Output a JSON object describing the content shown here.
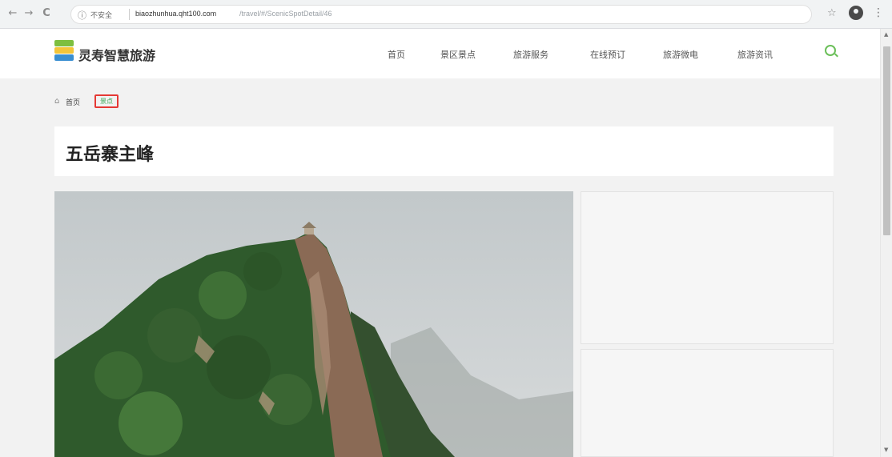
{
  "browser": {
    "back": "←",
    "forward": "→",
    "reload": "C",
    "info_icon": "ⓘ",
    "insecure": "不安全",
    "host": "biaozhunhua.qht100.com",
    "path": "/travel/#/ScenicSpotDetail/46",
    "star": "☆",
    "more": "⋮"
  },
  "header": {
    "site_title": "灵寿智慧旅游",
    "nav": [
      "首页",
      "景区景点",
      "旅游服务",
      "在线预订",
      "旅游微电",
      "旅游资讯"
    ]
  },
  "breadcrumb": {
    "home_icon": "⌂",
    "home": "首页",
    "current": "景点"
  },
  "page": {
    "title": "五岳寨主峰"
  },
  "scrollbar": {
    "up": "▲",
    "down": "▼"
  },
  "colors": {
    "accent": "#6bbf59",
    "highlight_border": "#e53935",
    "background": "#f2f2f2"
  }
}
